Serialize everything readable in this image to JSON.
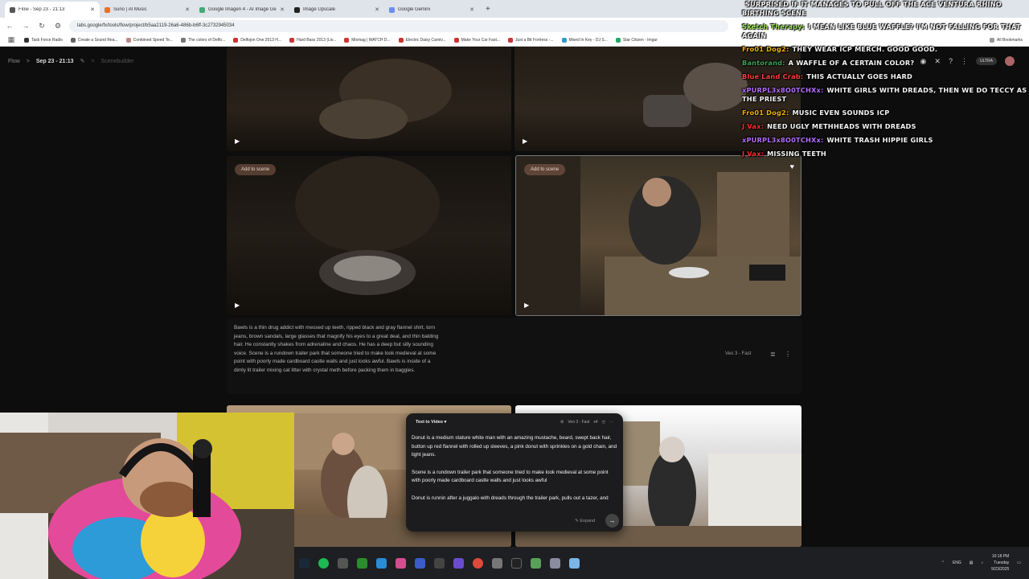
{
  "browser": {
    "tabs": [
      {
        "title": "Flow - Sep 23 - 21:13",
        "active": true
      },
      {
        "title": "Suno | AI Music",
        "active": false
      },
      {
        "title": "Google Imagen 4 - AI Image Ge",
        "active": false
      },
      {
        "title": "Image Upscale",
        "active": false
      },
      {
        "title": "Google Gemini",
        "active": false
      }
    ],
    "new_tab": "+",
    "url": "labs.google/fx/tools/flow/project/b5aa2119-26a6-486b-b6ff-3c2732945034",
    "bookmarks": [
      "Task Force Radio",
      "Create a Sound Rea...",
      "Combined Speed Te...",
      "The colors of Delfo...",
      "Delfojon One 2013 H...",
      "Hard Bass 2013 (Liv...",
      "Mixmag | WATCH D...",
      "Electric Daisy Carniv...",
      "Make Your Car Fast...",
      "Just a Bit Fortress -...",
      "Mixed In Key - DJ S...",
      "Star Citizen - Imgur"
    ],
    "all_bookmarks": "All Bookmarks"
  },
  "app": {
    "breadcrumb": {
      "root": "Flow",
      "sep": ">",
      "project": "Sep 23 - 21:13",
      "sep2": ">",
      "view": "Scenebuilder"
    },
    "ultra_badge": "ULTRA",
    "add_to_scene": "Add to scene",
    "prompt": "Bawls is a thin drug addict with messed up teeth, ripped black and gray flannel shirt, torn jeans, brown sandals, large glasses that magnify his eyes to a great deal, and thin balding hair. He constantly shakes from adrenaline and chaos. He has a deep but silly sounding voice. Scene is a rundown trailer park that someone tried to make look medieval at some point with poorly made cardboard castle walls and just looks awful. Bawls is inside of a dimly lit trailer mixing cat litter with crystal meth before packing them in baggies.",
    "model_label": "Veo 3 - Fast"
  },
  "composer": {
    "mode": "Text to Video",
    "model": "Veo 3 - Fast",
    "count": "x4",
    "paragraph1": "Donut is a medium stature white man with an amazing mustache, beard, swept back hair, button up red flannel with rolled up sleeves, a pink donut with sprinkles on a gold chain, and light jeans.",
    "paragraph2": "Scene is a rundown trailer park that someone tried to make look medieval at some point with poorly made cardboard castle walls and just looks awful",
    "paragraph3": "Donut is runnin after a juggalo with dreads through the trailer park, pulls out a tazer, and",
    "expand_label": "Expand",
    "send_icon": "→"
  },
  "chat": [
    {
      "user": "",
      "text": "SURPRISED IF IT MANAGES TO PULL OFF THE ACE VENTURA RHINO BIRTHING SCENE",
      "color": "#ffffff"
    },
    {
      "user": "Sketch Therapy:",
      "text": "I MEAN LIKE BLUE WAFFLE? I'M NOT FALLING FOR THAT AGAIN",
      "color": "#9be35a"
    },
    {
      "user": "Fro01 Dog2:",
      "text": "THEY WEAR ICP MERCH. GOOD GOOD.",
      "color": "#f0b000"
    },
    {
      "user": "Bantorand:",
      "text": "A WAFFLE OF A CERTAIN COLOR?",
      "color": "#3fa05a"
    },
    {
      "user": "Blue Land Crab:",
      "text": "THIS ACTUALLY GOES HARD",
      "color": "#ff3c3c"
    },
    {
      "user": "xPURPL3x8O0TCHXx:",
      "text": "WHITE GIRLS WITH DREADS, THEN WE DO TECCY AS THE PRIEST",
      "color": "#b46cff"
    },
    {
      "user": "Fro01 Dog2:",
      "text": "MUSIC EVEN SOUNDS ICP",
      "color": "#f0b000"
    },
    {
      "user": "J Vax:",
      "text": "NEED UGLY METHHEADS WITH DREADS",
      "color": "#ff2a2a"
    },
    {
      "user": "xPURPL3x8O0TCHXx:",
      "text": "WHITE TRASH HIPPIE GIRLS",
      "color": "#b46cff"
    },
    {
      "user": "J Vax:",
      "text": "MISSING TEETH",
      "color": "#ff2a2a"
    }
  ],
  "taskbar": {
    "lang": "ENG",
    "time": "10:18 PM",
    "day": "Tuesday",
    "date": "9/23/2025"
  }
}
